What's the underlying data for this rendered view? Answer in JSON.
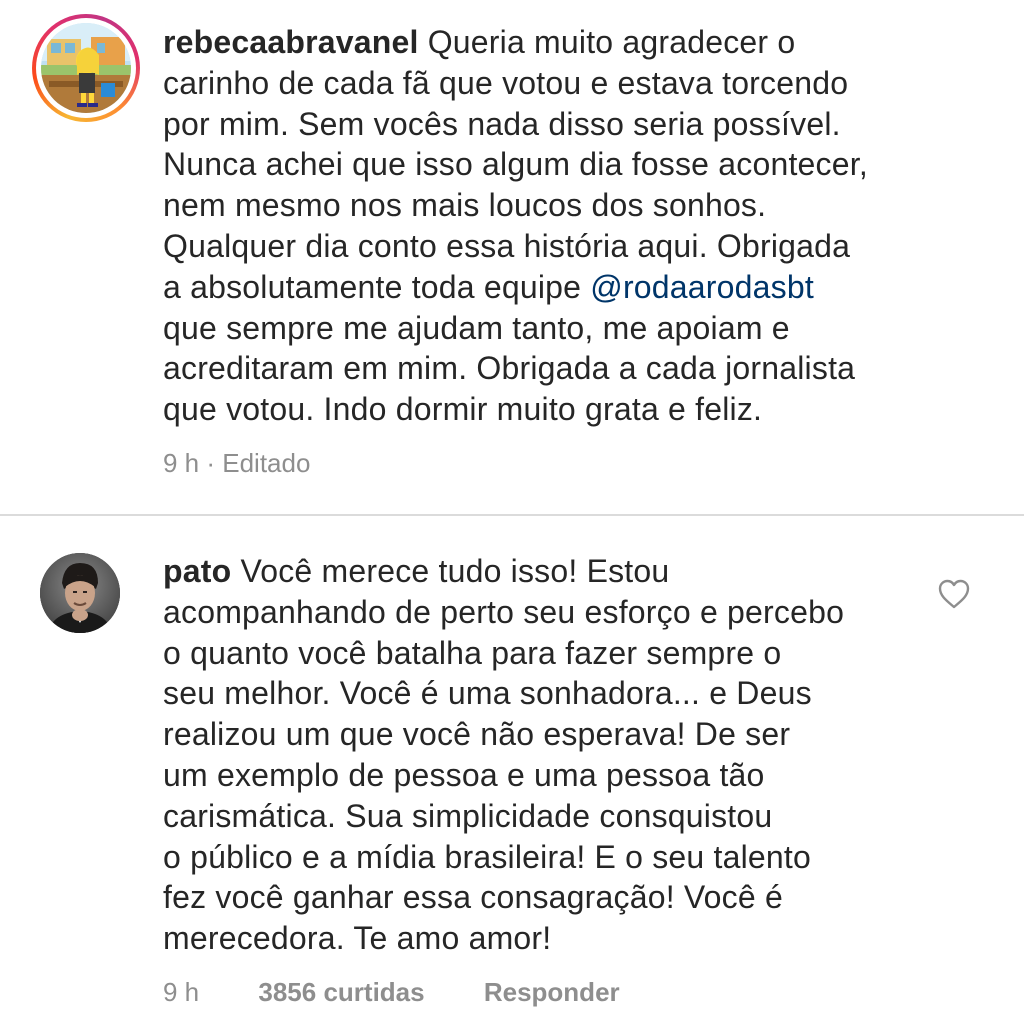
{
  "comments": [
    {
      "username": "rebecaabravanel",
      "text_before_mention": " Queria muito agradecer o\ncarinho de cada fã que votou e estava torcendo\npor mim. Sem vocês nada disso seria possível.\nNunca achei que isso algum dia fosse acontecer,\nnem mesmo nos mais loucos dos sonhos.\nQualquer dia conto essa história aqui. Obrigada\na absolutamente toda equipe ",
      "mention": "@rodaarodasbt",
      "text_after_mention": "\nque sempre me ajudam tanto, me apoiam e\nacreditaram em mim. Obrigada a cada jornalista\nque votou. Indo dormir muito grata e feliz.",
      "meta": "9 h · Editado",
      "avatar_icon": "cartoon-avatar-with-story-ring"
    },
    {
      "username": "pato",
      "text": " Você merece tudo isso! Estou\nacompanhando de perto seu esforço e percebo\no quanto você batalha para fazer sempre o\nseu melhor. Você é uma sonhadora... e Deus\nrealizou um que você não esperava! De ser\num exemplo de pessoa e uma pessoa tão\ncarismática. Sua simplicidade consquistou\no público e a mídia brasileira! E o seu talento\nfez você ganhar essa consagração! Você é\nmerecedora. Te amo amor!",
      "time": "9 h",
      "likes": "3856 curtidas",
      "reply_label": "Responder",
      "avatar_icon": "man-portrait-avatar",
      "like_icon": "heart-outline-icon"
    }
  ],
  "colors": {
    "text": "#262626",
    "meta": "#8e8e8e",
    "mention": "#003569",
    "divider": "#dbdbdb",
    "heart_outline": "#8e8e8e"
  }
}
